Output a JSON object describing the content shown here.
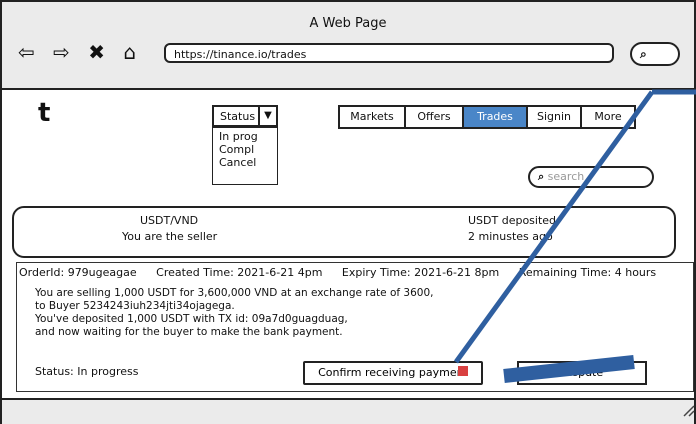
{
  "window": {
    "title": "A Web Page",
    "url": "https://tinance.io/trades",
    "icons": [
      "back-arrow-icon",
      "forward-arrow-icon",
      "close-icon",
      "home-icon",
      "search-icon"
    ]
  },
  "site": {
    "logo": "t",
    "status_filter": {
      "label": "Status",
      "options": [
        "In prog",
        "Compl",
        "Cancel"
      ]
    },
    "nav": [
      {
        "label": "Markets"
      },
      {
        "label": "Offers"
      },
      {
        "label": "Trades",
        "active": true
      },
      {
        "label": "Signin"
      },
      {
        "label": "More"
      }
    ],
    "search_placeholder": "search"
  },
  "summary": {
    "pair": "USDT/VND",
    "role": "You are the seller",
    "deposit_status": "USDT deposited",
    "deposit_time": "2 minustes ago"
  },
  "order": {
    "order_id": "OrderId: 979ugeagae",
    "created": "Created Time: 2021-6-21 4pm",
    "expiry": "Expiry Time: 2021-6-21 8pm",
    "remaining": "Remaining Time: 4 hours",
    "details": [
      "You are selling 1,000 USDT for 3,600,000 VND at an exchange rate of 3600,",
      "to Buyer 5234243iuh234jti34ojagega.",
      "You've deposited 1,000 USDT with TX id: 09a7d0guagduag,",
      "and now waiting for the buyer to make the bank payment."
    ],
    "status": "Status: In progress",
    "confirm_button": "Confirm receiving payment",
    "second_button": "Dispute"
  },
  "colors": {
    "active_tab": "#4a86c8",
    "annotation": "#2f5fa0"
  }
}
